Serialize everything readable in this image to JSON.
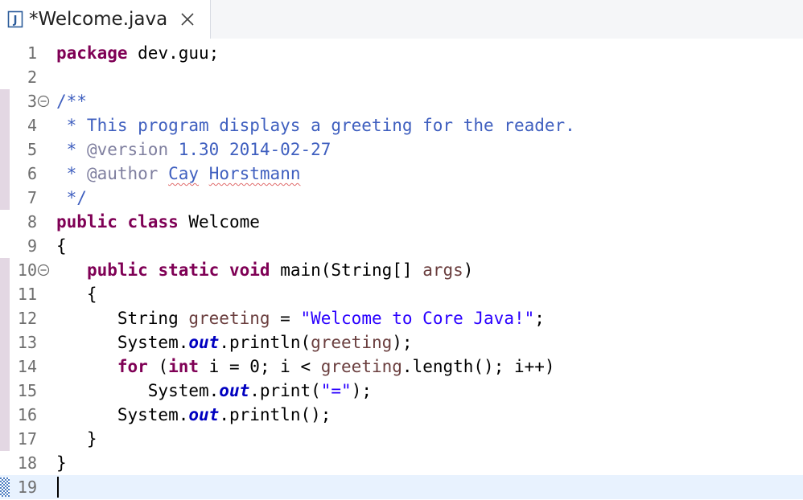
{
  "tab": {
    "title": "*Welcome.java",
    "icon": "java-file-icon",
    "close_icon": "close-icon"
  },
  "colors": {
    "keyword": "#7f0055",
    "comment": "#3f5fbf",
    "javadoc_tag": "#7f7f9f",
    "string": "#2a00ff",
    "static_field": "#0000c0",
    "local_variable": "#6a3e3e",
    "current_line": "#e8f2fe"
  },
  "editor": {
    "current_line": 19,
    "lines": [
      {
        "num": "1",
        "t": [
          [
            "package",
            "kw"
          ],
          [
            " dev.guu;",
            ""
          ]
        ]
      },
      {
        "num": "2",
        "t": []
      },
      {
        "num": "3",
        "fold": true,
        "t": [
          [
            "/**",
            "cm"
          ]
        ]
      },
      {
        "num": "4",
        "t": [
          [
            " * This program displays a greeting for the reader.",
            "cm"
          ]
        ]
      },
      {
        "num": "5",
        "t": [
          [
            " * ",
            "cm"
          ],
          [
            "@version",
            "tag"
          ],
          [
            " 1.30 2014-02-27",
            "cm"
          ]
        ]
      },
      {
        "num": "6",
        "t": [
          [
            " * ",
            "cm"
          ],
          [
            "@author",
            "tag"
          ],
          [
            " ",
            "cm"
          ],
          [
            "Cay",
            "cm spell"
          ],
          [
            " ",
            "cm"
          ],
          [
            "Horstmann",
            "cm spell"
          ]
        ]
      },
      {
        "num": "7",
        "t": [
          [
            " */",
            "cm"
          ]
        ]
      },
      {
        "num": "8",
        "t": [
          [
            "public",
            "kw"
          ],
          [
            " ",
            ""
          ],
          [
            "class",
            "kw"
          ],
          [
            " Welcome",
            ""
          ]
        ]
      },
      {
        "num": "9",
        "t": [
          [
            "{",
            ""
          ]
        ]
      },
      {
        "num": "10",
        "fold": true,
        "t": [
          [
            "   ",
            ""
          ],
          [
            "public",
            "kw"
          ],
          [
            " ",
            ""
          ],
          [
            "static",
            "kw"
          ],
          [
            " ",
            ""
          ],
          [
            "void",
            "kw"
          ],
          [
            " main(String[] ",
            ""
          ],
          [
            "args",
            "var"
          ],
          [
            ")",
            ""
          ]
        ]
      },
      {
        "num": "11",
        "t": [
          [
            "   {",
            ""
          ]
        ]
      },
      {
        "num": "12",
        "t": [
          [
            "      String ",
            ""
          ],
          [
            "greeting",
            "var"
          ],
          [
            " = ",
            ""
          ],
          [
            "\"Welcome to Core Java!\"",
            "str"
          ],
          [
            ";",
            ""
          ]
        ]
      },
      {
        "num": "13",
        "t": [
          [
            "      System.",
            ""
          ],
          [
            "out",
            "fld"
          ],
          [
            ".println(",
            ""
          ],
          [
            "greeting",
            "var"
          ],
          [
            ");",
            ""
          ]
        ]
      },
      {
        "num": "14",
        "t": [
          [
            "      ",
            ""
          ],
          [
            "for",
            "kw"
          ],
          [
            " (",
            ""
          ],
          [
            "int",
            "kw"
          ],
          [
            " i = 0; i < ",
            ""
          ],
          [
            "greeting",
            "var"
          ],
          [
            ".length(); i++)",
            ""
          ]
        ]
      },
      {
        "num": "15",
        "t": [
          [
            "         System.",
            ""
          ],
          [
            "out",
            "fld"
          ],
          [
            ".print(",
            ""
          ],
          [
            "\"=\"",
            "str"
          ],
          [
            ");",
            ""
          ]
        ]
      },
      {
        "num": "16",
        "t": [
          [
            "      System.",
            ""
          ],
          [
            "out",
            "fld"
          ],
          [
            ".println();",
            ""
          ]
        ]
      },
      {
        "num": "17",
        "t": [
          [
            "   }",
            ""
          ]
        ]
      },
      {
        "num": "18",
        "t": [
          [
            "}",
            ""
          ]
        ]
      },
      {
        "num": "19",
        "current": true,
        "bookmark": true,
        "t": []
      }
    ]
  }
}
